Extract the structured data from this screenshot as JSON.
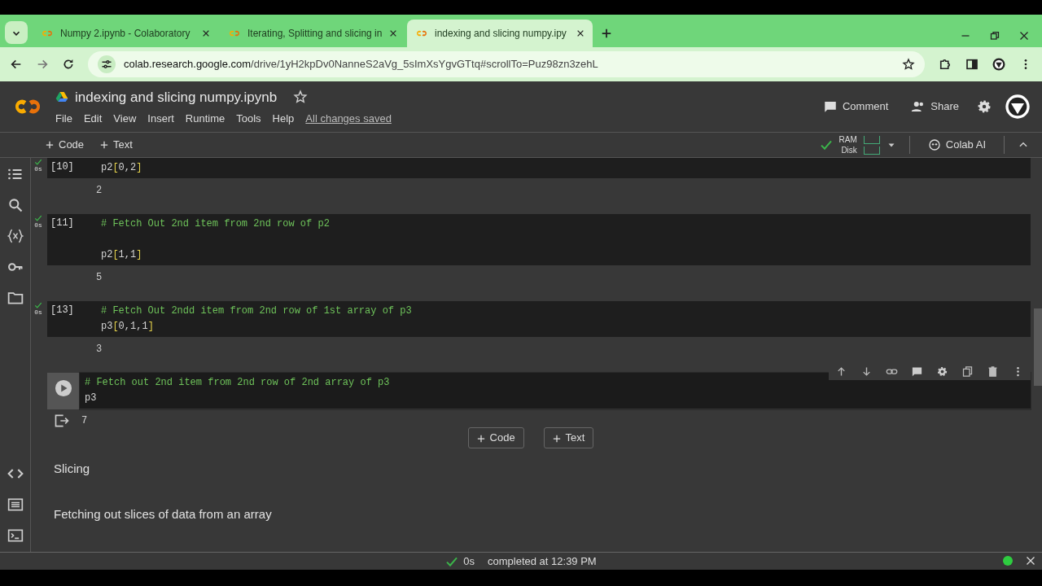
{
  "browser": {
    "tabs": [
      {
        "label": "Numpy 2.ipynb - Colaboratory",
        "selected": false
      },
      {
        "label": "Iterating, Splitting and slicing in",
        "selected": false
      },
      {
        "label": "indexing and slicing numpy.ipy",
        "selected": true
      }
    ],
    "url_host": "colab.research.google.com",
    "url_path": "/drive/1yH2kpDv0NanneS2aVg_5sImXsYgvGTtq#scrollTo=Puz98zn3zehL"
  },
  "notebook": {
    "title": "indexing and slicing numpy.ipynb",
    "menu": [
      "File",
      "Edit",
      "View",
      "Insert",
      "Runtime",
      "Tools",
      "Help"
    ],
    "save_status": "All changes saved",
    "comment": "Comment",
    "share": "Share"
  },
  "toolbar": {
    "add_code": "Code",
    "add_text": "Text",
    "ram": "RAM",
    "disk": "Disk",
    "colab_ai": "Colab AI"
  },
  "cells": [
    {
      "kind": "code",
      "prompt": "[10]",
      "executed": true,
      "time": "0s",
      "active": false,
      "lines": [
        {
          "kind": "code",
          "text": "p2[0,2]"
        }
      ],
      "output": "2"
    },
    {
      "kind": "code",
      "prompt": "[11]",
      "executed": true,
      "time": "0s",
      "active": false,
      "lines": [
        {
          "kind": "comment",
          "text": "# Fetch Out 2nd item from 2nd row of p2"
        },
        {
          "kind": "blank"
        },
        {
          "kind": "code",
          "text": "p2[1,1]"
        }
      ],
      "output": "5"
    },
    {
      "kind": "code",
      "prompt": "[13]",
      "executed": true,
      "time": "0s",
      "active": false,
      "lines": [
        {
          "kind": "comment",
          "text": "# Fetch Out 2ndd item from 2nd row of 1st array of p3"
        },
        {
          "kind": "code",
          "text": "p3[0,1,1]"
        }
      ],
      "output": "3"
    },
    {
      "kind": "code",
      "executed": false,
      "active": true,
      "lines": [
        {
          "kind": "comment",
          "text": "# Fetch out 2nd item from 2nd row of 2nd array of p3"
        },
        {
          "kind": "code",
          "text": "p3"
        }
      ],
      "output": "7"
    },
    {
      "kind": "add",
      "add_code": "Code",
      "add_text": "Text"
    },
    {
      "kind": "text",
      "text": "Slicing"
    },
    {
      "kind": "text",
      "text": "Fetching out slices of data from an array"
    }
  ],
  "status_bar": {
    "time": "0s",
    "message": "completed at 12:39 PM",
    "connected": true
  }
}
